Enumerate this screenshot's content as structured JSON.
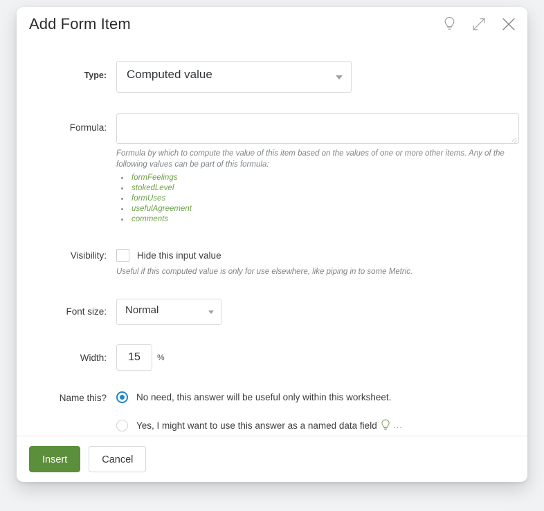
{
  "dialog": {
    "title": "Add Form Item",
    "header_icons": [
      {
        "name": "lightbulb-icon",
        "label": "Help"
      },
      {
        "name": "expand-icon",
        "label": "Expand"
      },
      {
        "name": "close-icon",
        "label": "Close"
      }
    ]
  },
  "fields": {
    "type": {
      "label": "Type:",
      "value": "Computed value"
    },
    "formula": {
      "label": "Formula:",
      "value": "",
      "placeholder": "",
      "help": "Formula by which to compute the value of this item based on the values of one or more other items. Any of the following values can be part of this formula:",
      "variables": [
        "formFeelings",
        "stokedLevel",
        "formUses",
        "usefulAgreement",
        "comments"
      ]
    },
    "visibility": {
      "label": "Visibility:",
      "checkbox_label": "Hide this input value",
      "checked": false,
      "help": "Useful if this computed value is only for use elsewhere, like piping in to some Metric."
    },
    "font_size": {
      "label": "Font size:",
      "value": "Normal"
    },
    "width": {
      "label": "Width:",
      "value": "15",
      "unit": "%"
    },
    "name_this": {
      "label": "Name this?",
      "options": [
        {
          "label": "No need, this answer will be useful only within this worksheet.",
          "selected": true,
          "bulb": false,
          "ellipsis": ""
        },
        {
          "label": "Yes, I might want to use this answer as a named data field",
          "selected": false,
          "bulb": true,
          "ellipsis": "..."
        }
      ]
    }
  },
  "footer": {
    "insert_label": "Insert",
    "cancel_label": "Cancel"
  },
  "colors": {
    "primary_green": "#5c8f3b",
    "variable_green": "#6fa24d",
    "radio_blue": "#1b87c9",
    "page_background": "#f1f2f3",
    "dialog_background": "#ffffff"
  }
}
